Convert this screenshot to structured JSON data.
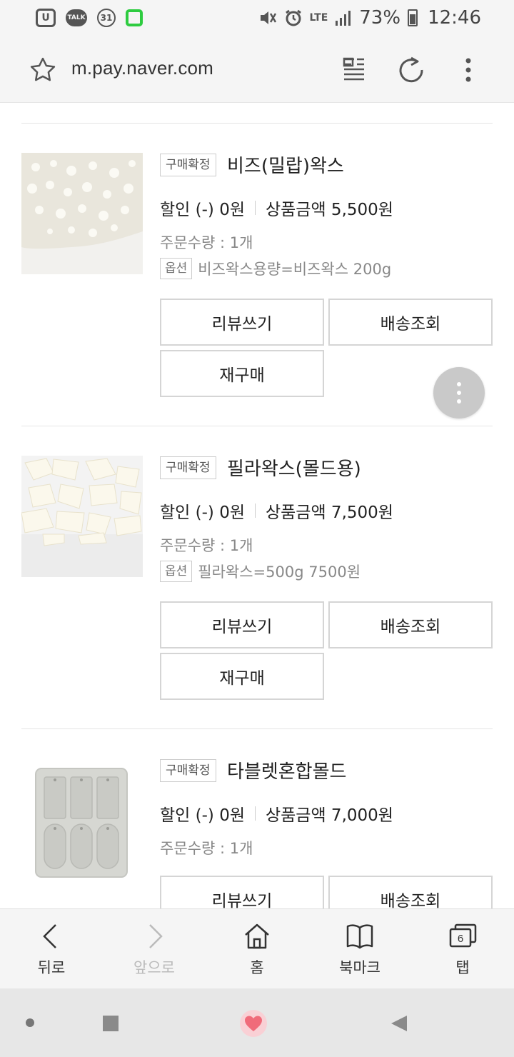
{
  "status_bar": {
    "u_label": "U",
    "talk_label": "TALK",
    "calendar_label": "31",
    "network": "LTE",
    "battery": "73%",
    "time": "12:46"
  },
  "url_bar": {
    "url": "m.pay.naver.com"
  },
  "orders": [
    {
      "badge": "구매확정",
      "title": "비즈(밀랍)왁스",
      "discount": "할인 (-) 0원",
      "amount": "상품금액 5,500원",
      "quantity": "주문수량 : 1개",
      "option_badge": "옵션",
      "option_text": "비즈왁스용량=비즈왁스 200g",
      "btn_review": "리뷰쓰기",
      "btn_shipping": "배송조회",
      "btn_rebuy": "재구매"
    },
    {
      "badge": "구매확정",
      "title": "필라왁스(몰드용)",
      "discount": "할인 (-) 0원",
      "amount": "상품금액 7,500원",
      "quantity": "주문수량 : 1개",
      "option_badge": "옵션",
      "option_text": "필라왁스=500g 7500원",
      "btn_review": "리뷰쓰기",
      "btn_shipping": "배송조회",
      "btn_rebuy": "재구매"
    },
    {
      "badge": "구매확정",
      "title": "타블렛혼합몰드",
      "discount": "할인 (-) 0원",
      "amount": "상품금액 7,000원",
      "quantity": "주문수량 : 1개",
      "btn_review": "리뷰쓰기",
      "btn_shipping": "배송조회"
    }
  ],
  "toolbar": {
    "back": "뒤로",
    "forward": "앞으로",
    "home": "홈",
    "bookmarks": "북마크",
    "tabs": "탭",
    "tab_count": "6"
  },
  "colors": {
    "accent_green": "#2ecc40",
    "nav_home_pink": "#f06b7a"
  }
}
